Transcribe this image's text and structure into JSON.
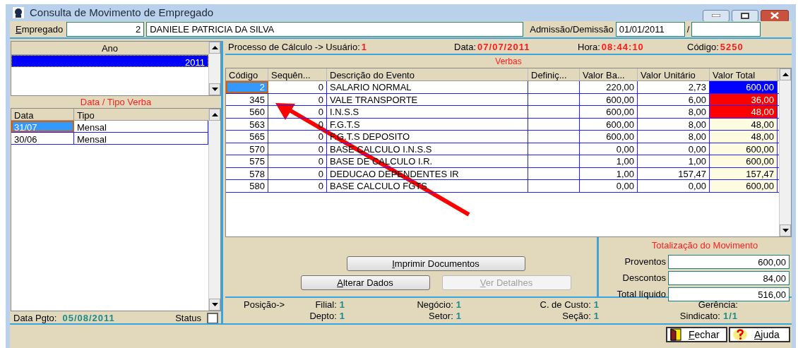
{
  "window": {
    "title": "Consulta de Movimento de Empregado"
  },
  "employee": {
    "label": "Empregado",
    "code": "2",
    "name": "DANIELE PATRICIA DA SILVA",
    "dates_label": "Admissão/Demissão",
    "admission": "01/01/2011",
    "separator": "/"
  },
  "ano_list": {
    "header": "Ano",
    "rows": [
      {
        "value": "2011",
        "selected": true
      }
    ]
  },
  "verba_list": {
    "title": "Data / Tipo Verba",
    "columns": [
      "Data",
      "Tipo"
    ],
    "rows": [
      {
        "data": "31/07",
        "tipo": "Mensal",
        "selected": true
      },
      {
        "data": "30/06",
        "tipo": "Mensal",
        "selected": false
      }
    ]
  },
  "payment": {
    "label": "Data Pgto:",
    "value": "05/08/2011",
    "status_label": "Status",
    "status_checked": false
  },
  "process": [
    {
      "label": "Processo de Cálculo -> Usuário:",
      "value": "1"
    },
    {
      "label": "Data:",
      "value": "07/07/2011"
    },
    {
      "label": "Hora:",
      "value": "08:44:10"
    },
    {
      "label": "Código:",
      "value": "5250"
    }
  ],
  "verbas": {
    "title": "Verbas",
    "columns": [
      "Código",
      "Sequên...",
      "Descrição do Evento",
      "Definiç...",
      "Valor Ba...",
      "Valor Unitário",
      "Valor Total"
    ],
    "rows": [
      {
        "cells": [
          "2",
          "0",
          "SALARIO NORMAL",
          "",
          "220,00",
          "2,73",
          "600,00"
        ],
        "selected": true,
        "color": "#0000ff"
      },
      {
        "cells": [
          "345",
          "0",
          "VALE TRANSPORTE",
          "",
          "600,00",
          "6,00",
          "36,00"
        ],
        "selected": false,
        "color": "#ff0000"
      },
      {
        "cells": [
          "560",
          "0",
          "I.N.S.S",
          "",
          "600,00",
          "8,00",
          "48,00"
        ],
        "selected": false,
        "color": "#ff0000"
      },
      {
        "cells": [
          "563",
          "0",
          "F.G.T.S",
          "",
          "600,00",
          "8,00",
          "48,00"
        ],
        "selected": false,
        "color": "#fdfbe0"
      },
      {
        "cells": [
          "565",
          "0",
          "F.G.T.S DEPOSITO",
          "",
          "600,00",
          "8,00",
          "48,00"
        ],
        "selected": false,
        "color": "#fdfbe0"
      },
      {
        "cells": [
          "570",
          "0",
          "BASE CALCULO I.N.S.S",
          "",
          "0,00",
          "0,00",
          "600,00"
        ],
        "selected": false,
        "color": "#fdfbe0"
      },
      {
        "cells": [
          "575",
          "0",
          "BASE DE CALCULO I.R.",
          "",
          "1,00",
          "1,00",
          "600,00"
        ],
        "selected": false,
        "color": "#fdfbe0"
      },
      {
        "cells": [
          "578",
          "0",
          "DEDUCAO DEPENDENTES IR",
          "",
          "1,00",
          "157,47",
          "157,47"
        ],
        "selected": false,
        "color": "#fdfbe0"
      },
      {
        "cells": [
          "580",
          "0",
          "BASE CALCULO FGTS",
          "",
          "0,00",
          "0,00",
          "600,00"
        ],
        "selected": false,
        "color": "#fdfbe0"
      }
    ]
  },
  "actions": [
    {
      "label": "Imprimir Documentos",
      "disabled": false
    },
    {
      "label": "Alterar Dados",
      "disabled": false
    },
    {
      "label": "Ver Detalhes",
      "disabled": true
    }
  ],
  "totals": {
    "title": "Totalização do Movimento",
    "fields": [
      {
        "label": "Proventos",
        "value": "600,00"
      },
      {
        "label": "Descontos",
        "value": "84,00"
      },
      {
        "label": "Total líquido",
        "value": "516,00"
      }
    ]
  },
  "position": {
    "heading": "Posição->",
    "rows": [
      [
        {
          "label": "Filial:",
          "value": "1"
        },
        {
          "label": "Negócio:",
          "value": "1"
        },
        {
          "label": "C. de Custo:",
          "value": "1"
        },
        {
          "label": "Gerência:"
        }
      ],
      [
        {
          "label": "Depto:",
          "value": "1"
        },
        {
          "label": "Setor:",
          "value": "1"
        },
        {
          "label": "Seção:",
          "value": "1"
        },
        {
          "label": "Sindicato:",
          "value": "1/1"
        }
      ]
    ]
  },
  "footer_buttons": [
    {
      "label": "Fechar",
      "kind": "close"
    },
    {
      "label": "Ajuda",
      "kind": "help"
    }
  ]
}
